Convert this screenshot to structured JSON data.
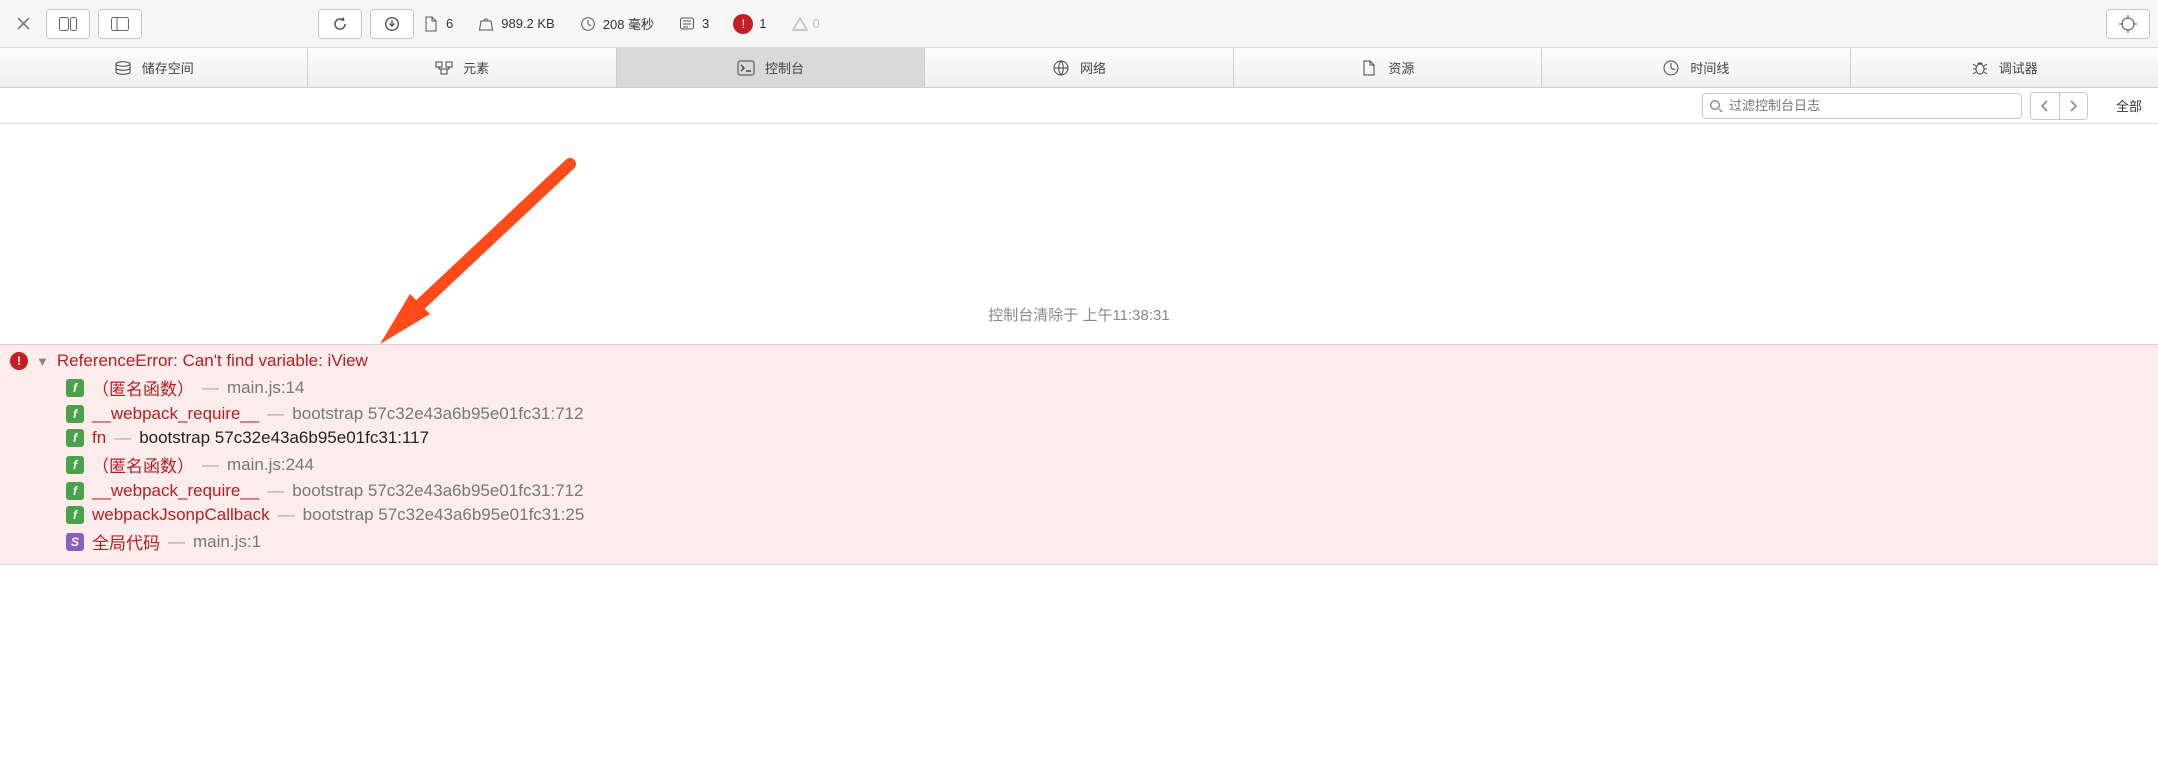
{
  "toolbar": {
    "resources_count": "6",
    "transfer_size": "989.2 KB",
    "load_time": "208 毫秒",
    "logs_count": "3",
    "errors_count": "1",
    "warnings_count": "0"
  },
  "tabs": [
    {
      "id": "storage",
      "label": "储存空间"
    },
    {
      "id": "elements",
      "label": "元素"
    },
    {
      "id": "console",
      "label": "控制台",
      "active": true
    },
    {
      "id": "network",
      "label": "网络"
    },
    {
      "id": "sources",
      "label": "资源"
    },
    {
      "id": "timeline",
      "label": "时间线"
    },
    {
      "id": "debugger",
      "label": "调试器"
    }
  ],
  "filter": {
    "placeholder": "过滤控制台日志",
    "scope": "全部"
  },
  "cleared_message": "控制台清除于 上午11:38:31",
  "error": {
    "title": "ReferenceError: Can't find variable: iView",
    "stack": [
      {
        "badge": "f",
        "fn": "（匿名函数）",
        "loc": "main.js:14",
        "dark": false
      },
      {
        "badge": "f",
        "fn": "__webpack_require__",
        "loc": "bootstrap 57c32e43a6b95e01fc31:712",
        "dark": false
      },
      {
        "badge": "f",
        "fn": "fn",
        "loc": "bootstrap 57c32e43a6b95e01fc31:117",
        "dark": true
      },
      {
        "badge": "f",
        "fn": "（匿名函数）",
        "loc": "main.js:244",
        "dark": false
      },
      {
        "badge": "f",
        "fn": "__webpack_require__",
        "loc": "bootstrap 57c32e43a6b95e01fc31:712",
        "dark": false
      },
      {
        "badge": "f",
        "fn": "webpackJsonpCallback",
        "loc": "bootstrap 57c32e43a6b95e01fc31:25",
        "dark": false
      },
      {
        "badge": "s",
        "fn": "全局代码",
        "loc": "main.js:1",
        "dark": false
      }
    ]
  }
}
